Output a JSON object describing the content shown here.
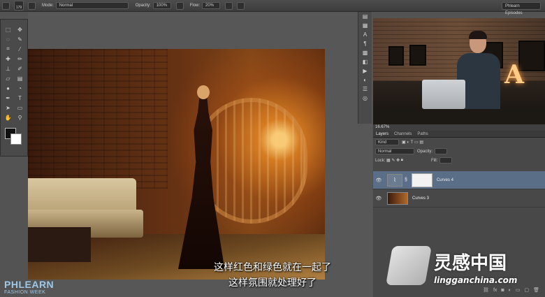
{
  "options_bar": {
    "brush_size": "179",
    "mode_label": "Mode:",
    "mode_value": "Normal",
    "opacity_label": "Opacity:",
    "opacity_value": "100%",
    "flow_label": "Flow:",
    "flow_value": "20%",
    "workspace": "Phlearn Episodes"
  },
  "tools": [
    "selection-move",
    "lasso",
    "crop",
    "eyedropper",
    "healing",
    "brush",
    "stamp",
    "history",
    "eraser",
    "gradient",
    "blur",
    "dodge",
    "pen",
    "type",
    "path-select",
    "shape",
    "hand",
    "zoom"
  ],
  "navigator": {
    "zoom": "16.67%"
  },
  "panel_tabs": {
    "a": "Layers",
    "b": "Channels",
    "c": "Paths"
  },
  "layers": {
    "kind_label": "Kind",
    "blend_mode": "Normal",
    "opacity_label": "Opacity:",
    "lock_label": "Lock:",
    "fill_label": "Fill:",
    "items": [
      {
        "name": "Curves 4",
        "selected": true
      },
      {
        "name": "Curves 3",
        "selected": false
      }
    ]
  },
  "subtitles": {
    "line1": "这样红色和绿色就在一起了",
    "line2": "这样氛围就处理好了"
  },
  "watermark_left": {
    "brand": "PHLEARN",
    "sub": "FASHION WEEK"
  },
  "watermark_right": {
    "cn": "灵感中国",
    "url": "lingganchina.com"
  }
}
